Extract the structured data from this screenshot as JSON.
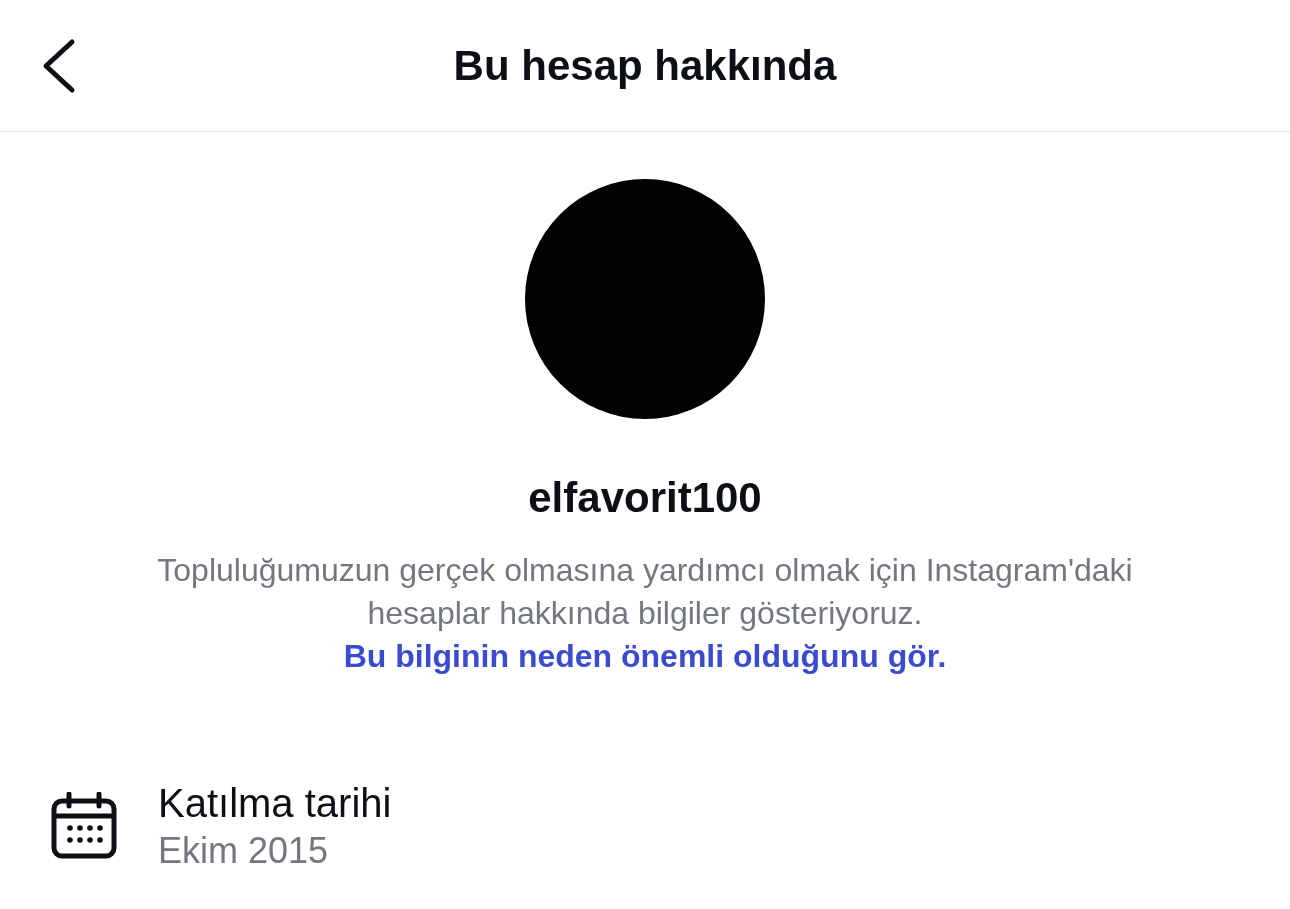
{
  "header": {
    "title": "Bu hesap hakkında"
  },
  "profile": {
    "avatar": {
      "kind": "avatar"
    },
    "username": "elfavorit100"
  },
  "notice": {
    "text": "Topluluğumuzun gerçek olmasına yardımcı olmak için Instagram'daki hesaplar hakkında bilgiler gösteriyoruz.",
    "link": "Bu bilginin neden önemli olduğunu gör."
  },
  "details": [
    {
      "kind": "date",
      "label": "Katılma tarihi",
      "value": "Ekim 2015"
    }
  ]
}
